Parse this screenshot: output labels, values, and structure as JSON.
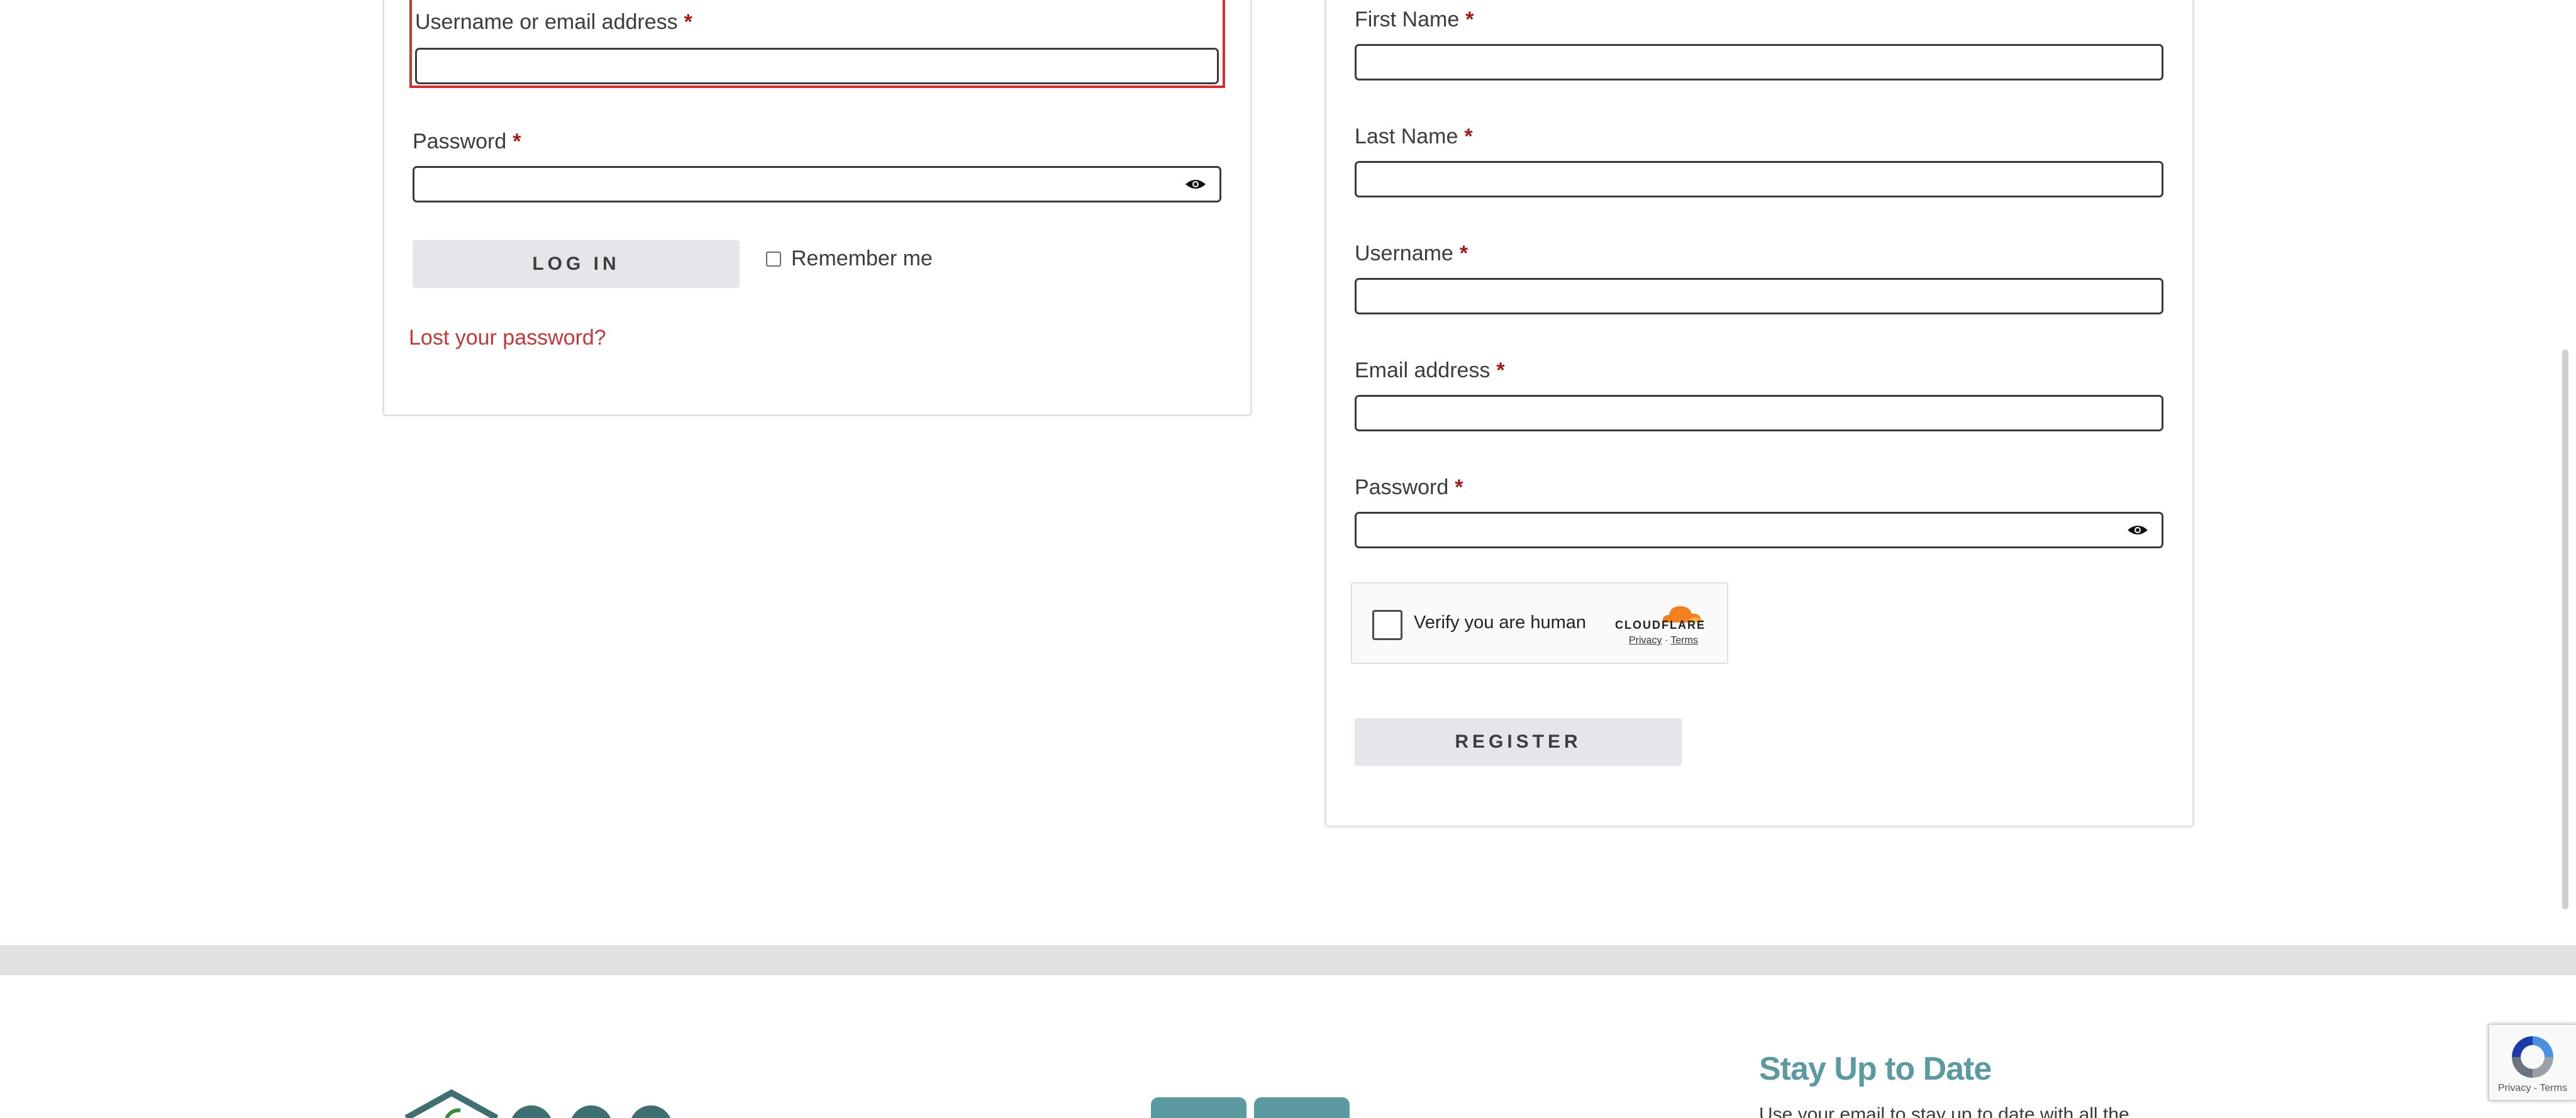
{
  "login": {
    "username_label": "Username or email address",
    "password_label": "Password",
    "required_mark": "*",
    "login_button": "LOG IN",
    "remember_label": "Remember me",
    "lost_password": "Lost your password?"
  },
  "register": {
    "first_name_label": "First Name",
    "last_name_label": "Last Name",
    "username_label": "Username",
    "email_label": "Email address",
    "password_label": "Password",
    "required_mark": "*",
    "register_button": "REGISTER"
  },
  "turnstile": {
    "verify_text": "Verify you are human",
    "brand": "CLOUDFLARE",
    "privacy": "Privacy",
    "separator": "·",
    "terms": "Terms"
  },
  "footer": {
    "newsletter_title": "Stay Up to Date",
    "newsletter_text": "Use your email to stay up to date with all the"
  },
  "recaptcha": {
    "legal": "Privacy - Terms"
  },
  "colors": {
    "error": "#d2302f",
    "required": "#a11a1a",
    "link": "#c0383a",
    "button_bg": "#e7e5ea",
    "accent_teal": "#5c9aa2"
  }
}
